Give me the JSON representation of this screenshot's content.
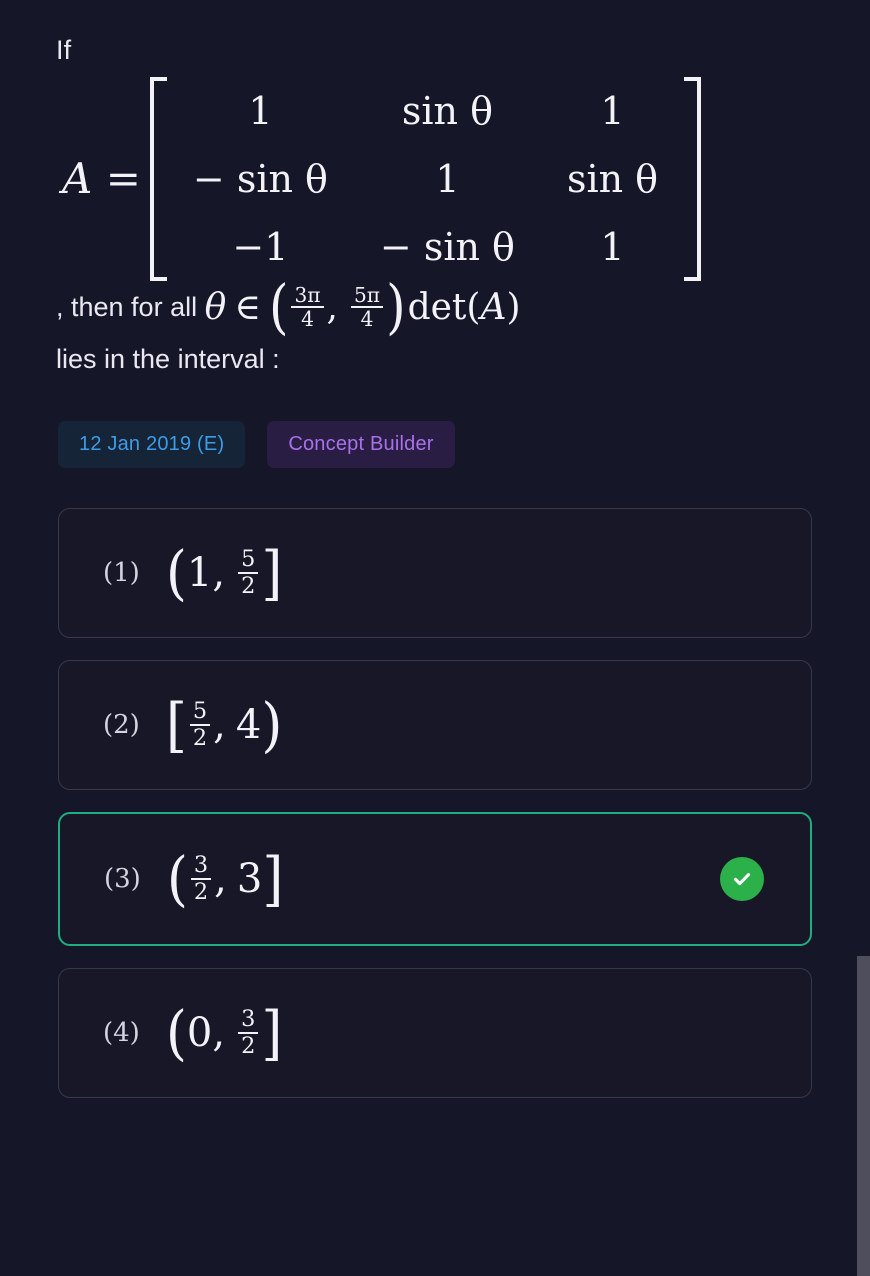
{
  "question": {
    "intro": "If",
    "matrix_label": "A =",
    "matrix": [
      [
        "1",
        "sin θ",
        "1"
      ],
      [
        "− sin θ",
        "1",
        "sin θ"
      ],
      [
        "−1",
        "− sin θ",
        "1"
      ]
    ],
    "condition_prefix": ", then for all ",
    "theta_symbol": "θ",
    "membership_symbol": "∈",
    "interval_open": "(",
    "interval_lower_num": "3π",
    "interval_lower_den": "4",
    "interval_comma": ",",
    "interval_upper_num": "5π",
    "interval_upper_den": "4",
    "interval_close": ")",
    "condition_suffix": ", det(A)",
    "det_text": "det(",
    "det_var": "A",
    "det_close": ")",
    "closing_line": "lies in the interval :"
  },
  "tags": [
    {
      "label": "12 Jan 2019 (E)",
      "kind": "date",
      "color": "#3c9ce9",
      "background": "#152437"
    },
    {
      "label": "Concept Builder",
      "kind": "concept",
      "color": "#a971e9",
      "background": "#2a1d44"
    }
  ],
  "options": [
    {
      "number": "(1)",
      "open_bracket": "(",
      "left": "1",
      "comma": ",",
      "right_num": "5",
      "right_den": "2",
      "right_plain": "",
      "close_bracket": "]",
      "correct": false
    },
    {
      "number": "(2)",
      "open_bracket": "[",
      "left_num": "5",
      "left_den": "2",
      "comma": ",",
      "right_plain": "4",
      "close_bracket": ")",
      "correct": false
    },
    {
      "number": "(3)",
      "open_bracket": "(",
      "left_num": "3",
      "left_den": "2",
      "comma": ",",
      "right_plain": "3",
      "close_bracket": "]",
      "correct": true
    },
    {
      "number": "(4)",
      "open_bracket": "(",
      "left": "0",
      "comma": ",",
      "right_num": "3",
      "right_den": "2",
      "close_bracket": "]",
      "correct": false
    }
  ],
  "answer": {
    "correct_option_number": "(3)",
    "indicator_icon": "check-circle-icon",
    "indicator_color": "#2cb14a"
  },
  "theme": {
    "background": "#161629",
    "card_background": "#171728",
    "card_border": "#383848",
    "correct_border": "#1fae81",
    "text": "#e9e9f2",
    "math_text": "#f2f2f7",
    "scrollbar": "#4e4e5c"
  }
}
